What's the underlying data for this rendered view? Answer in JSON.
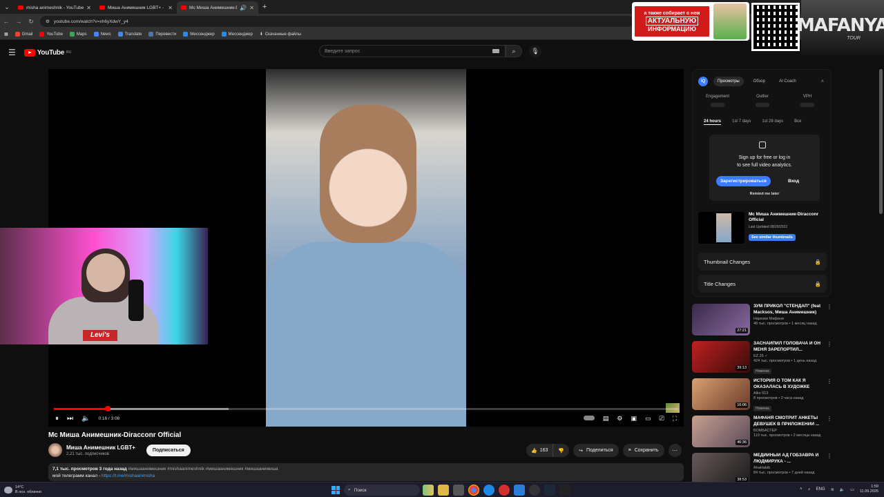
{
  "browser": {
    "tabs": [
      {
        "title": "misha animeshnik - YouTube",
        "active": false
      },
      {
        "title": "Миша Анимешник LGBT+ - Yo",
        "active": false
      },
      {
        "title": "Мс Миша Анимешник-Dir",
        "active": true
      }
    ],
    "url": "youtube.com/watch?v=xh6yXdwY_y4",
    "bookmarks": [
      "Gmail",
      "YouTube",
      "Maps",
      "News",
      "Translate",
      "Перевести",
      "Мессенджер",
      "Мессенджер",
      "Скачанные файлы"
    ]
  },
  "overlay": {
    "banner_line1": "а также собирает о нем",
    "banner_line2": "АКТУАЛЬНУЮ",
    "banner_line3": "ИНФОРМАЦИЮ",
    "brand": "MAFANYA",
    "brand_sub": "TOUR"
  },
  "header": {
    "logo": "YouTube",
    "logo_region": "RU",
    "search_placeholder": "Введите запрос"
  },
  "player": {
    "current_time": "0:16",
    "duration": "3:08",
    "time_display": "0:16 / 3:08",
    "played_fraction": 0.086,
    "buffered_fraction": 0.28
  },
  "webcam": {
    "shirt_logo": "Levi's"
  },
  "video": {
    "title": "Мс Миша Анимешник-Diracconr Official",
    "channel": "Миша Анимешник LGBT+",
    "subscribers": "2,21 тыс. подписчиков",
    "subscribe_label": "Подписаться",
    "likes": "163",
    "share_label": "Поделиться",
    "save_label": "Сохранить",
    "views_date": "7,1 тыс. просмотров  3 года назад",
    "tags": "#мишаанимешник #mishaanimeshnik #мишаанимешник #мишаанимиша",
    "desc_line": "мой телеграмм канал - ",
    "desc_link": "https://t.me/mishaanimisha"
  },
  "ext": {
    "logo": "iQ",
    "tabs": [
      "Просмотры",
      "Обзор",
      "AI Coach"
    ],
    "metrics": [
      "Engagement",
      "Outlier",
      "VPH"
    ],
    "ranges": [
      "24 hours",
      "1st 7 days",
      "1st 28 days",
      "Все"
    ],
    "lock_line1": "Sign up for free or log in",
    "lock_line2": "to see full video analytics.",
    "register": "Зарегистрироваться",
    "login": "Вход",
    "remind": "Remind me later",
    "thumb_title": "Мс Миша Анимешник-Diracconr Official",
    "thumb_date": "Last Updated 08/29/2022",
    "similar": "See similar thumbnails",
    "thumbnail_changes": "Thumbnail Changes",
    "title_changes": "Title Changes"
  },
  "recommendations": [
    {
      "title": "ЗУМ ПРИКОЛ \"СТЕНДАП\" (feat Macksos, Миша Анимешник)",
      "channel": "Нарезки Мафани",
      "meta": "48 тыс. просмотров • 1 месяц назад",
      "duration": "27:21",
      "badge": "",
      "color": "#6a4a8a"
    },
    {
      "title": "ЗАСНАЙПИЛ ГОЛОВАЧА И ОН МЕНЯ ЗАРЕПОРТИЛ...",
      "channel": "EZ 25 ✓",
      "meta": "424 тыс. просмотров • 1 день назад",
      "duration": "39:13",
      "badge": "Новинка",
      "color": "#8a1a1a"
    },
    {
      "title": "ИСТОРИЯ О ТОМ КАК Я ОКАЗАЛАСЬ В ХУДОЖКЕ",
      "channel": "Alko 513",
      "meta": "8 просмотров • 2 часа назад",
      "duration": "16:06",
      "badge": "Новинка",
      "color": "#b77a4a"
    },
    {
      "title": "МАФАНЯ СМОТРИТ АНКЕТЫ ДЕВУШЕК В ПРИЛОЖЕНИИ ...",
      "channel": "БОМБАСТЕР",
      "meta": "119 тыс. просмотров • 2 месяца назад",
      "duration": "46:36",
      "badge": "",
      "color": "#9a7a6a"
    },
    {
      "title": "МЕДИЙНЫЙ АД ГОБЗАВРА И ЛЮДМИРУКА - ...",
      "channel": "AhaHabib",
      "meta": "84 тыс. просмотров • 7 дней назад",
      "duration": "38:53",
      "badge": "",
      "color": "#4a3a3a"
    }
  ],
  "taskbar": {
    "temp": "14°C",
    "weather": "В осн. облачно",
    "search_label": "Поиск",
    "lang": "ENG",
    "time": "1:59",
    "date": "11.09.2025"
  }
}
